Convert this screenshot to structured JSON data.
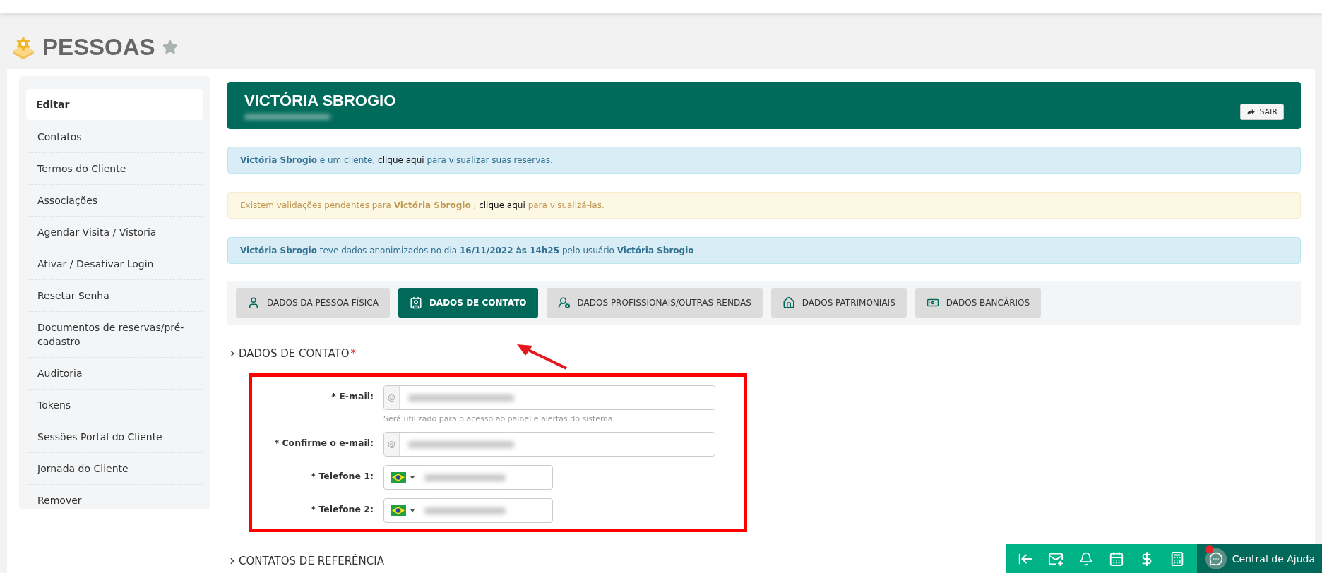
{
  "page": {
    "title": "PESSOAS",
    "favorite": false
  },
  "sidebar": {
    "items": [
      {
        "label": "Editar",
        "selected": true
      },
      {
        "label": "Contatos",
        "selected": false
      },
      {
        "label": "Termos do Cliente",
        "selected": false
      },
      {
        "label": "Associações",
        "selected": false
      },
      {
        "label": "Agendar Visita / Vistoria",
        "selected": false
      },
      {
        "label": "Ativar / Desativar Login",
        "selected": false
      },
      {
        "label": "Resetar Senha",
        "selected": false
      },
      {
        "label": "Documentos de reservas/pré-cadastro",
        "selected": false
      },
      {
        "label": "Auditoria",
        "selected": false
      },
      {
        "label": "Tokens",
        "selected": false
      },
      {
        "label": "Sessões Portal do Cliente",
        "selected": false
      },
      {
        "label": "Jornada do Cliente",
        "selected": false
      },
      {
        "label": "Remover",
        "selected": false
      }
    ]
  },
  "profile": {
    "name": "VICTÓRIA SBROGIO",
    "exit_button": "SAIR"
  },
  "alerts": [
    {
      "kind": "info",
      "before": "**Victória Sbrogio** é um cliente,",
      "link": "clique aqui",
      "after": "para visualizar suas reservas."
    },
    {
      "kind": "warning",
      "before": "Existem validações pendentes para **Victória Sbrogio** ,",
      "link": "clique aqui",
      "after": "para visualizá-las."
    },
    {
      "kind": "info",
      "before": "**Victória Sbrogio** teve dados anonimizados no dia **16/11/2022 às 14h25** pelo usuário **Victória Sbrogio**"
    }
  ],
  "tabs": [
    {
      "label": "DADOS DA PESSOA FÍSICA",
      "selected": false
    },
    {
      "label": "DADOS DE CONTATO",
      "selected": true
    },
    {
      "label": "DADOS PROFISSIONAIS/OUTRAS RENDAS",
      "selected": false
    },
    {
      "label": "DADOS PATRIMONIAIS",
      "selected": false
    },
    {
      "label": "DADOS BANCÁRIOS",
      "selected": false
    }
  ],
  "sections": [
    {
      "title": "DADOS DE CONTATO",
      "required_mark": "*",
      "fields": [
        {
          "kind": "email",
          "label": "* E-mail:",
          "addon": "@",
          "help": "Será utilizado para o acesso ao painel e alertas do sistema."
        },
        {
          "kind": "email",
          "label": "* Confirme o e-mail:",
          "addon": "@"
        },
        {
          "kind": "phone",
          "label": "* Telefone 1:"
        },
        {
          "kind": "phone",
          "label": "* Telefone 2:"
        }
      ]
    },
    {
      "title": "CONTATOS DE REFERÊNCIA"
    }
  ],
  "annotation": {
    "frame": true,
    "arrow": true
  },
  "help": {
    "label": "Central de Ajuda",
    "notification": true
  }
}
